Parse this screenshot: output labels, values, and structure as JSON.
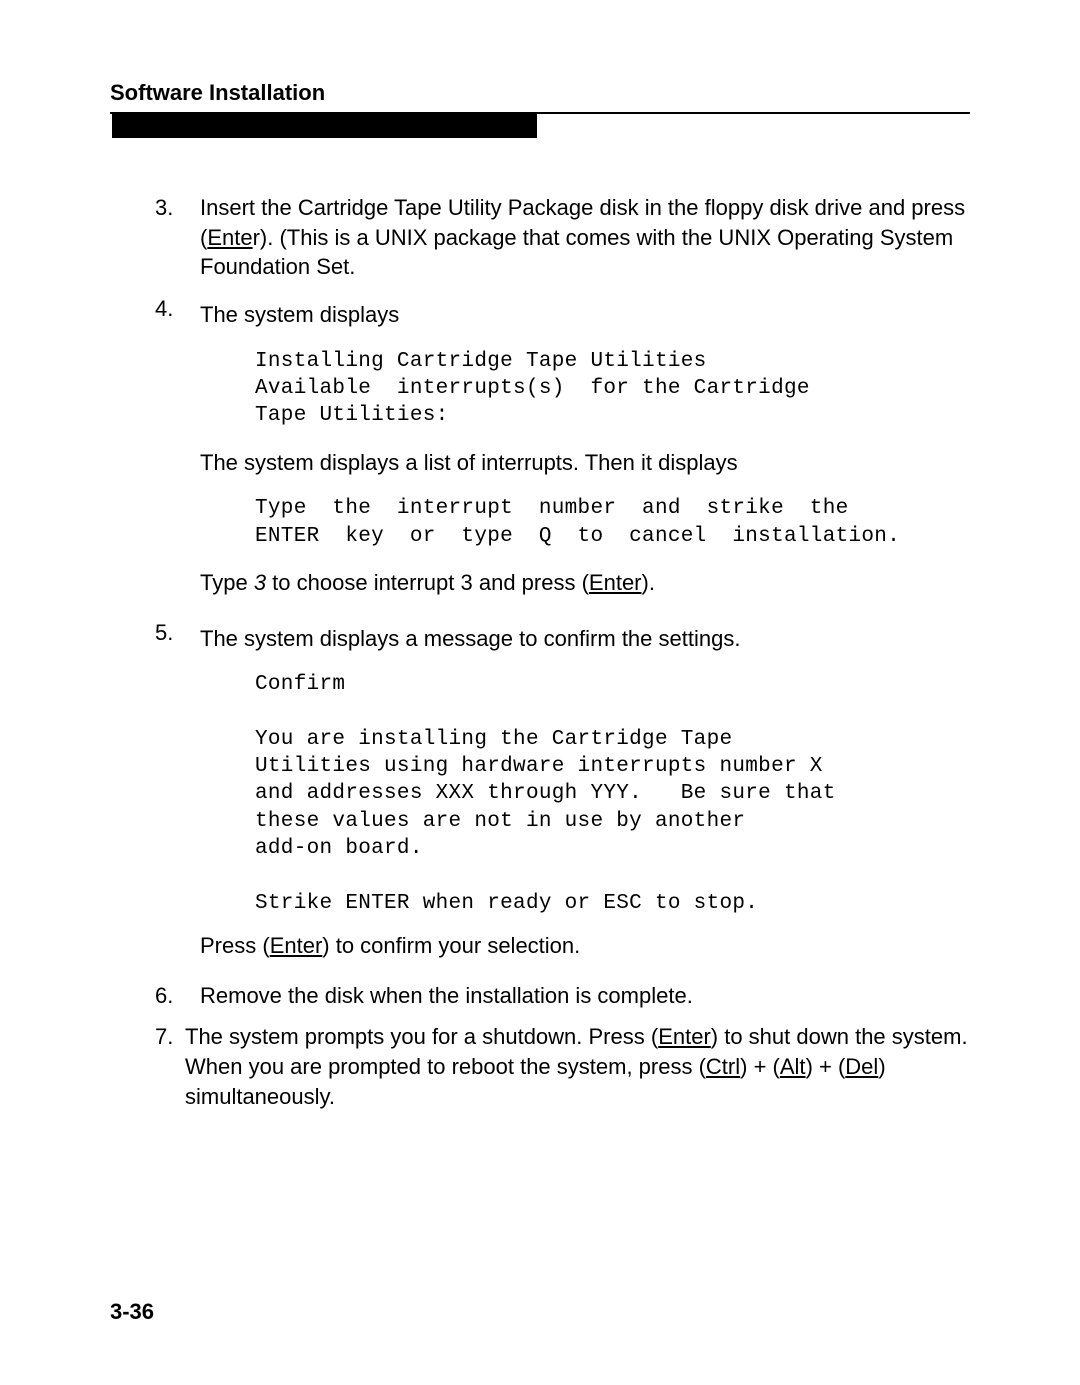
{
  "header": {
    "section_title": "Software Installation"
  },
  "steps": {
    "s3": {
      "num": "3.",
      "text_prefix": "Insert the Cartridge Tape Utility Package disk in the floppy disk drive and press ",
      "key1_open": "(",
      "key1": "Ente",
      "key1_close": "r).",
      "text_suffix": "  (This  is  a  UNIX  package  that  comes  with the UNIX Operating System Foundation Set."
    },
    "s4": {
      "num": "4.",
      "intro": "The  system  displays",
      "code1": "Installing Cartridge Tape Utilities\nAvailable  interrupts(s)  for the Cartridge\nTape Utilities:",
      "mid": "The system displays a list of interrupts.   Then  it  displays",
      "code2": "Type  the  interrupt  number  and  strike  the\nENTER  key  or  type  Q  to  cancel  installation.",
      "after_prefix": "Type ",
      "after_italic": "3",
      "after_mid": " to choose interrupt 3 and press (",
      "after_key": "Enter",
      "after_close": ")."
    },
    "s5": {
      "num": "5.",
      "intro": "The system displays a message to confirm the settings.",
      "code1": "Confirm\n\nYou are installing the Cartridge Tape\nUtilities using hardware interrupts number X\nand addresses XXX through YYY.   Be sure that\nthese values are not in use by another\nadd-on board.\n\nStrike ENTER when ready or ESC to stop.",
      "after_prefix": "Press  (",
      "after_key": "Enter",
      "after_suffix": ")  to  confirm  your  selection."
    },
    "s6": {
      "num": "6.",
      "text": "Remove the disk when the installation is complete."
    },
    "s7": {
      "num": "7.",
      "prefix": "The system prompts you for a shutdown. Press (",
      "key1": "Enter",
      "mid1": ") to shut down  the  system.  When  you  are  prompted  to  reboot  the  system, press  (",
      "key2": "Ctrl",
      "mid2": ")  +  (",
      "key3": "Alt",
      "mid3": ")  +  (",
      "key4": "Del",
      "suffix": ")  simultaneously."
    }
  },
  "page_number": "3-36"
}
